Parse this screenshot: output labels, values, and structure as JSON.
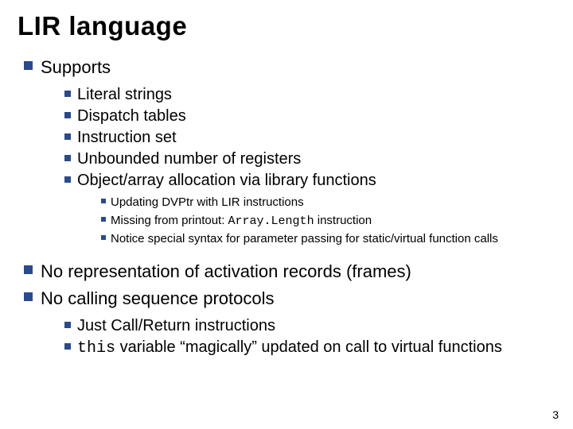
{
  "title": "LIR language",
  "b1": "Supports",
  "b1a": "Literal strings",
  "b1b": "Dispatch tables",
  "b1c": "Instruction set",
  "b1d": "Unbounded number of registers",
  "b1e": "Object/array allocation via library functions",
  "b1e1": "Updating DVPtr with LIR instructions",
  "b1e2a": "Missing from printout: ",
  "b1e2b": "Array.Length",
  "b1e2c": " instruction",
  "b1e3": "Notice special syntax for parameter passing for static/virtual function calls",
  "b2": "No representation of activation records (frames)",
  "b3": "No calling sequence protocols",
  "b3a": "Just Call/Return instructions",
  "b3b1": "this",
  "b3b2": " variable “magically” updated on call to virtual functions",
  "page": "3"
}
